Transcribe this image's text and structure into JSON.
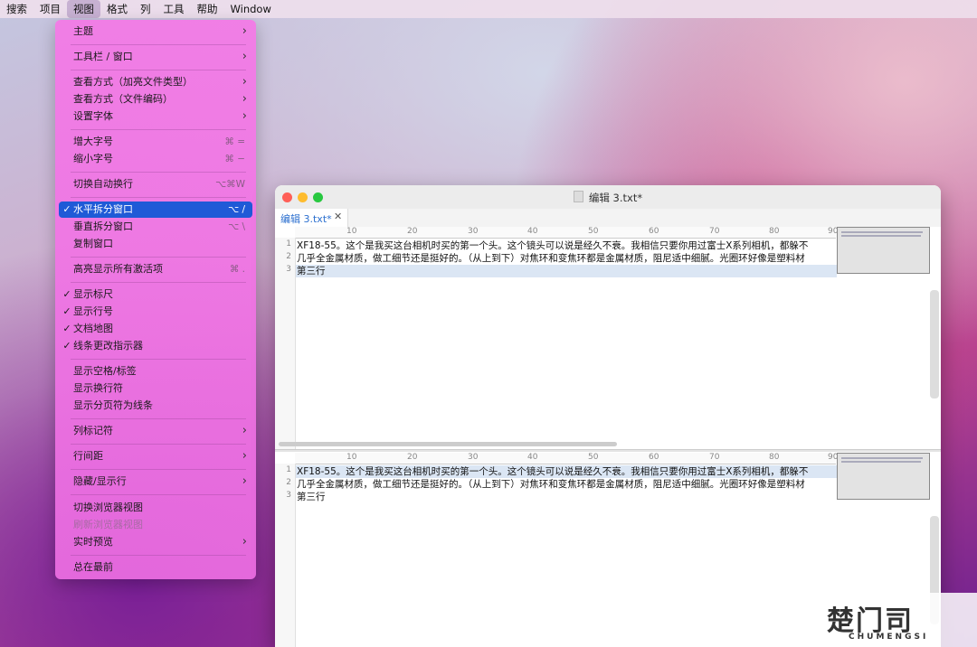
{
  "menubar": {
    "items": [
      "搜索",
      "项目",
      "视图",
      "格式",
      "列",
      "工具",
      "帮助",
      "Window"
    ],
    "active_index": 2
  },
  "view_menu": {
    "items": [
      {
        "label": "主题",
        "submenu": true
      },
      {
        "label": "工具栏 / 窗口",
        "submenu": true
      },
      {
        "label": "查看方式（加亮文件类型）",
        "submenu": true
      },
      {
        "label": "查看方式（文件编码）",
        "submenu": true
      },
      {
        "label": "设置字体",
        "submenu": true
      },
      {
        "label": "增大字号",
        "shortcut": "⌘ ="
      },
      {
        "label": "缩小字号",
        "shortcut": "⌘ −"
      },
      {
        "label": "切换自动换行",
        "shortcut": "⌥⌘W"
      },
      {
        "label": "水平拆分窗口",
        "shortcut": "⌥ /",
        "checked": true,
        "highlighted": true
      },
      {
        "label": "垂直拆分窗口",
        "shortcut": "⌥ \\"
      },
      {
        "label": "复制窗口"
      },
      {
        "label": "高亮显示所有激活项",
        "shortcut": "⌘ ."
      },
      {
        "label": "显示标尺",
        "checked": true
      },
      {
        "label": "显示行号",
        "checked": true
      },
      {
        "label": "文档地图",
        "checked": true
      },
      {
        "label": "线条更改指示器",
        "checked": true
      },
      {
        "label": "显示空格/标签"
      },
      {
        "label": "显示换行符"
      },
      {
        "label": "显示分页符为线条"
      },
      {
        "label": "列标记符",
        "submenu": true
      },
      {
        "label": "行间距",
        "submenu": true
      },
      {
        "label": "隐藏/显示行",
        "submenu": true
      },
      {
        "label": "切换浏览器视图"
      },
      {
        "label": "刷新浏览器视图",
        "disabled": true
      },
      {
        "label": "实时预览",
        "submenu": true
      },
      {
        "label": "总在最前"
      }
    ],
    "check_glyph": "✓",
    "arrow_glyph": "›"
  },
  "editor": {
    "title": "编辑 3.txt*",
    "tab_label": "编辑 3.txt*",
    "tab_close": "✕",
    "ruler_marks": [
      "10",
      "20",
      "30",
      "40",
      "50",
      "60",
      "70",
      "80",
      "90"
    ],
    "lines": [
      {
        "num": "1",
        "text": "XF18-55。这个是我买这台相机时买的第一个头。这个镜头可以说是经久不衰。我相信只要你用过富士X系列相机，都躲不"
      },
      {
        "num": "2",
        "text": "几乎全金属材质，做工细节还是挺好的。（从上到下）对焦环和变焦环都是金属材质，阻尼适中细腻。光圈环好像是塑料材"
      },
      {
        "num": "3",
        "text": "第三行"
      }
    ],
    "current_line": 3,
    "colors": {
      "accent": "#1f5ad7",
      "tab_text": "#2b6fcf",
      "current_line": "#dbe6f4"
    }
  },
  "watermark": {
    "main": "楚门司",
    "sub": "CHUMENGSI"
  }
}
